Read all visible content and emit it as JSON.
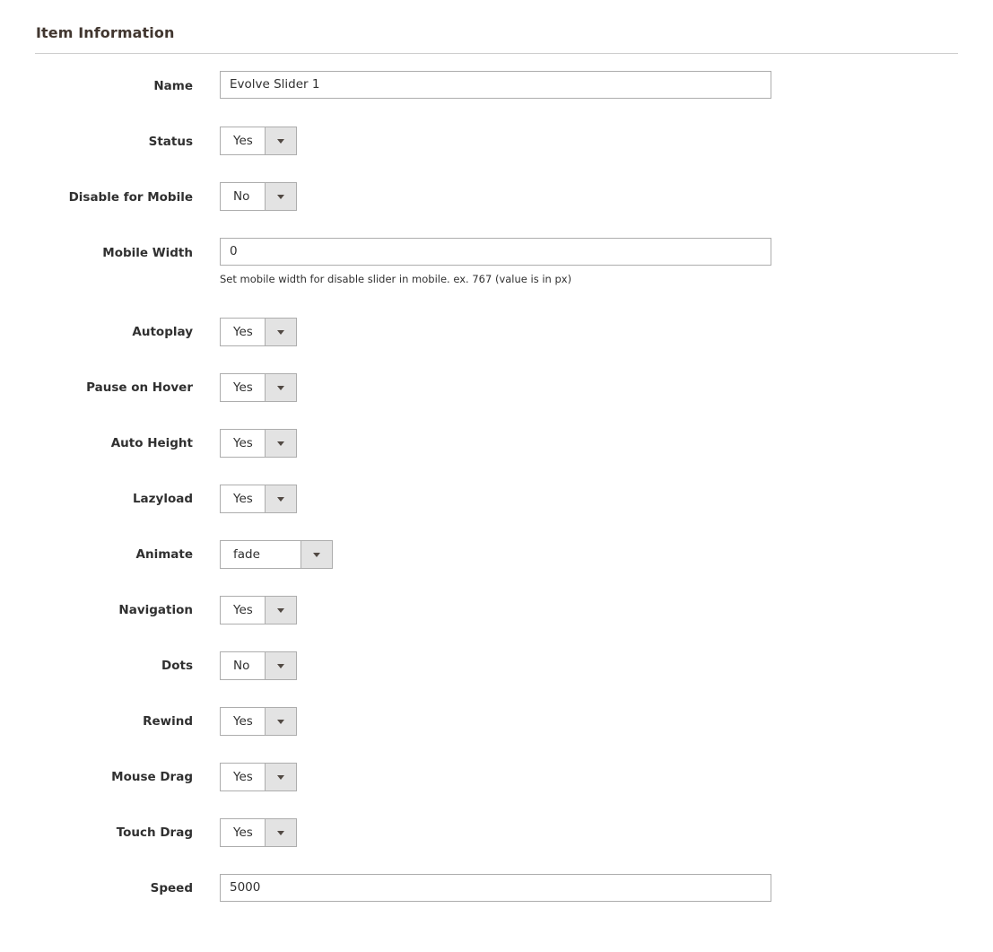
{
  "section": {
    "title": "Item Information"
  },
  "fields": {
    "name": {
      "label": "Name",
      "value": "Evolve Slider 1"
    },
    "status": {
      "label": "Status",
      "value": "Yes"
    },
    "disable_mobile": {
      "label": "Disable for Mobile",
      "value": "No"
    },
    "mobile_width": {
      "label": "Mobile Width",
      "value": "0",
      "note": "Set mobile width for disable slider in mobile. ex. 767 (value is in px)"
    },
    "autoplay": {
      "label": "Autoplay",
      "value": "Yes"
    },
    "pause_hover": {
      "label": "Pause on Hover",
      "value": "Yes"
    },
    "auto_height": {
      "label": "Auto Height",
      "value": "Yes"
    },
    "lazyload": {
      "label": "Lazyload",
      "value": "Yes"
    },
    "animate": {
      "label": "Animate",
      "value": "fade"
    },
    "navigation": {
      "label": "Navigation",
      "value": "Yes"
    },
    "dots": {
      "label": "Dots",
      "value": "No"
    },
    "rewind": {
      "label": "Rewind",
      "value": "Yes"
    },
    "mouse_drag": {
      "label": "Mouse Drag",
      "value": "Yes"
    },
    "touch_drag": {
      "label": "Touch Drag",
      "value": "Yes"
    },
    "speed": {
      "label": "Speed",
      "value": "5000"
    }
  },
  "icons": {
    "select_arrow": "chevron-down-icon"
  },
  "colors": {
    "border": "#adadad",
    "arrow_bg": "#e3e3e3",
    "label": "#303030"
  }
}
